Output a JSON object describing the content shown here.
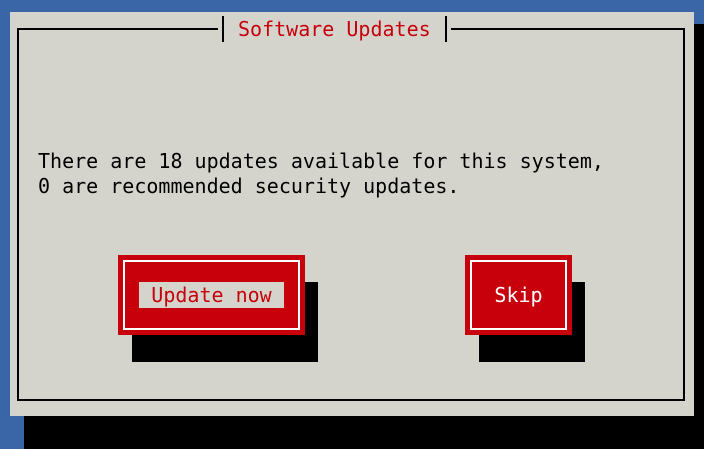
{
  "dialog": {
    "title": "Software Updates",
    "message": "There are 18 updates available for this system,\n0 are recommended security updates."
  },
  "buttons": {
    "update_label": "Update now",
    "skip_label": "Skip"
  },
  "colors": {
    "background": "#3a66a8",
    "dialog": "#d4d4cc",
    "accent": "#c8000c",
    "shadow": "#000000"
  }
}
